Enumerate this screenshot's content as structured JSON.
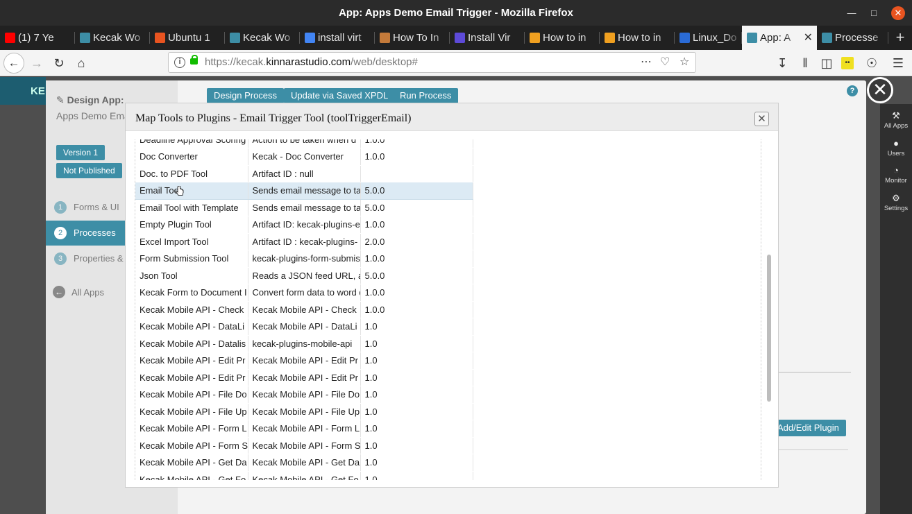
{
  "window": {
    "title": "App: Apps Demo Email Trigger - Mozilla Firefox"
  },
  "tabs": [
    {
      "label": "(1) 7 Ye",
      "icon": "youtube-icon",
      "color": "#ff0000"
    },
    {
      "label": "Kecak Wo",
      "icon": "kecak-icon",
      "color": "#3d8ea6"
    },
    {
      "label": "Ubuntu 1",
      "icon": "ubuntu-icon",
      "color": "#e95420"
    },
    {
      "label": "Kecak Wo",
      "icon": "kecak-icon",
      "color": "#3d8ea6"
    },
    {
      "label": "install virt",
      "icon": "google-icon",
      "color": "#4285f4"
    },
    {
      "label": "How To In",
      "icon": "site-icon",
      "color": "#c47a3a"
    },
    {
      "label": "Install Vir",
      "icon": "site-icon",
      "color": "#5d4ad8"
    },
    {
      "label": "How to in",
      "icon": "foss-linux-icon",
      "color": "#f0a020"
    },
    {
      "label": "How to in",
      "icon": "foss-linux-icon",
      "color": "#f0a020"
    },
    {
      "label": "Linux_Do",
      "icon": "site-icon",
      "color": "#2a6bd6"
    },
    {
      "label": "App: A",
      "icon": "kecak-icon",
      "color": "#3d8ea6",
      "active": true
    },
    {
      "label": "Processe",
      "icon": "kecak-icon",
      "color": "#3d8ea6"
    }
  ],
  "nav": {
    "url_prefix": "https://kecak.",
    "url_domain": "kinnarastudio.com",
    "url_path": "/web/desktop#"
  },
  "brand": {
    "label": "KE"
  },
  "left": {
    "title": "Design App:",
    "app_name": "Apps Demo Email Trigger",
    "version": "Version 1",
    "status": "Not Published",
    "steps": [
      {
        "num": "1",
        "label": "Forms & UI"
      },
      {
        "num": "2",
        "label": "Processes",
        "active": true
      },
      {
        "num": "3",
        "label": "Properties &"
      }
    ],
    "all_apps": "All Apps"
  },
  "toolbar": {
    "design": "Design Process",
    "update": "Update via Saved XPDL",
    "run": "Run Process"
  },
  "rightbar": [
    {
      "label": "All Apps",
      "icon": "wrench-icon"
    },
    {
      "label": "Users",
      "icon": "user-icon"
    },
    {
      "label": "Monitor",
      "icon": "dashboard-icon"
    },
    {
      "label": "Settings",
      "icon": "gears-icon"
    }
  ],
  "behind": {
    "add_edit": "Add/Edit Plugin"
  },
  "modal": {
    "title": "Map Tools to Plugins - Email Trigger Tool (toolTriggerEmail)",
    "rows": [
      [
        "Deadline Approval Scoring",
        "Action to be taken when d",
        "1.0.0"
      ],
      [
        "Doc Converter",
        "Kecak - Doc Converter",
        "1.0.0"
      ],
      [
        "Doc. to PDF Tool",
        "Artifact ID : null",
        ""
      ],
      [
        "Email Tool",
        "Sends email message to ta",
        "5.0.0"
      ],
      [
        "Email Tool with Template",
        "Sends email message to ta",
        "5.0.0"
      ],
      [
        "Empty Plugin Tool",
        "Artifact ID: kecak-plugins-e",
        "1.0.0"
      ],
      [
        "Excel Import Tool",
        "Artifact ID : kecak-plugins-",
        "2.0.0"
      ],
      [
        "Form Submission Tool",
        "kecak-plugins-form-submis",
        "1.0.0"
      ],
      [
        "Json Tool",
        "Reads a JSON feed URL, a",
        "5.0.0"
      ],
      [
        "Kecak Form to Document I",
        "Convert form data to word d",
        "1.0.0"
      ],
      [
        "Kecak Mobile API - Check",
        "Kecak Mobile API - Check",
        "1.0.0"
      ],
      [
        "Kecak Mobile API - DataLi",
        "Kecak Mobile API - DataLi",
        "1.0"
      ],
      [
        "Kecak Mobile API - Datalis",
        "kecak-plugins-mobile-api",
        "1.0"
      ],
      [
        "Kecak Mobile API - Edit Pr",
        "Kecak Mobile API - Edit Pr",
        "1.0"
      ],
      [
        "Kecak Mobile API - Edit Pr",
        "Kecak Mobile API - Edit Pr",
        "1.0"
      ],
      [
        "Kecak Mobile API - File Do",
        "Kecak Mobile API - File Do",
        "1.0"
      ],
      [
        "Kecak Mobile API - File Up",
        "Kecak Mobile API - File Up",
        "1.0"
      ],
      [
        "Kecak Mobile API - Form L",
        "Kecak Mobile API - Form L",
        "1.0"
      ],
      [
        "Kecak Mobile API - Form S",
        "Kecak Mobile API - Form S",
        "1.0"
      ],
      [
        "Kecak Mobile API - Get Da",
        "Kecak Mobile API - Get Da",
        "1.0"
      ],
      [
        "Kecak Mobile API - Get Fo",
        "Kecak Mobile API - Get Fo",
        "1.0"
      ]
    ],
    "selected_index": 3
  }
}
